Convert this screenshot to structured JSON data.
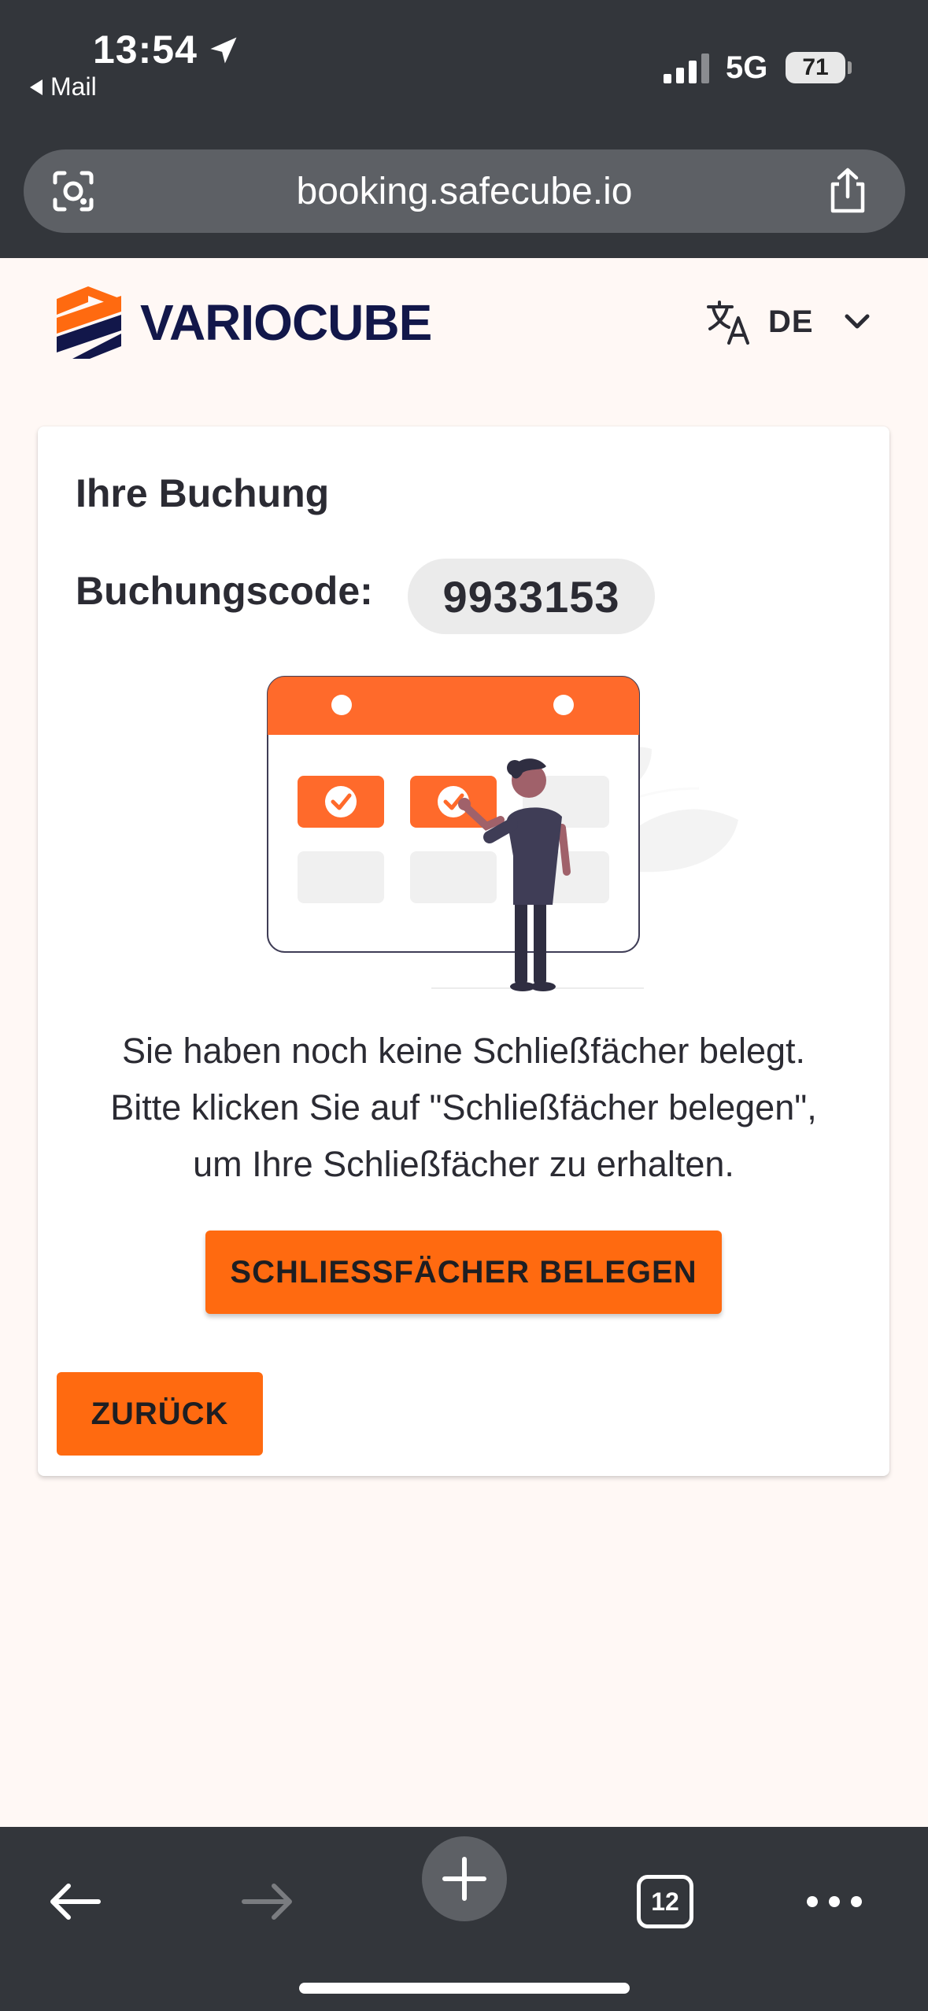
{
  "status_bar": {
    "time": "13:54",
    "back_app": "Mail",
    "network": "5G",
    "battery": "71"
  },
  "browser": {
    "url": "booking.safecube.io",
    "tab_count": "12"
  },
  "header": {
    "brand": "VARIOCUBE",
    "language_code": "DE"
  },
  "card": {
    "title": "Ihre Buchung",
    "code_label": "Buchungscode:",
    "code_value": "9933153",
    "message_lines": [
      "Sie haben noch keine Schließfächer belegt.",
      "Bitte klicken Sie auf \"Schließfächer belegen\",",
      "um Ihre Schließfächer zu erhalten."
    ],
    "primary_button": "SCHLIESSFÄCHER BELEGEN",
    "back_button": "ZURÜCK"
  },
  "colors": {
    "accent": "#ff6a10",
    "brand_navy": "#12174a",
    "chrome": "#33363b",
    "background": "#fff8f5"
  },
  "icons": [
    "location-arrow-icon",
    "signal-icon",
    "battery-icon",
    "lens-icon",
    "share-icon",
    "brand-logo",
    "translate-icon",
    "chevron-down-icon",
    "back-arrow-icon",
    "forward-arrow-icon",
    "plus-icon",
    "tabs-icon",
    "more-icon"
  ]
}
